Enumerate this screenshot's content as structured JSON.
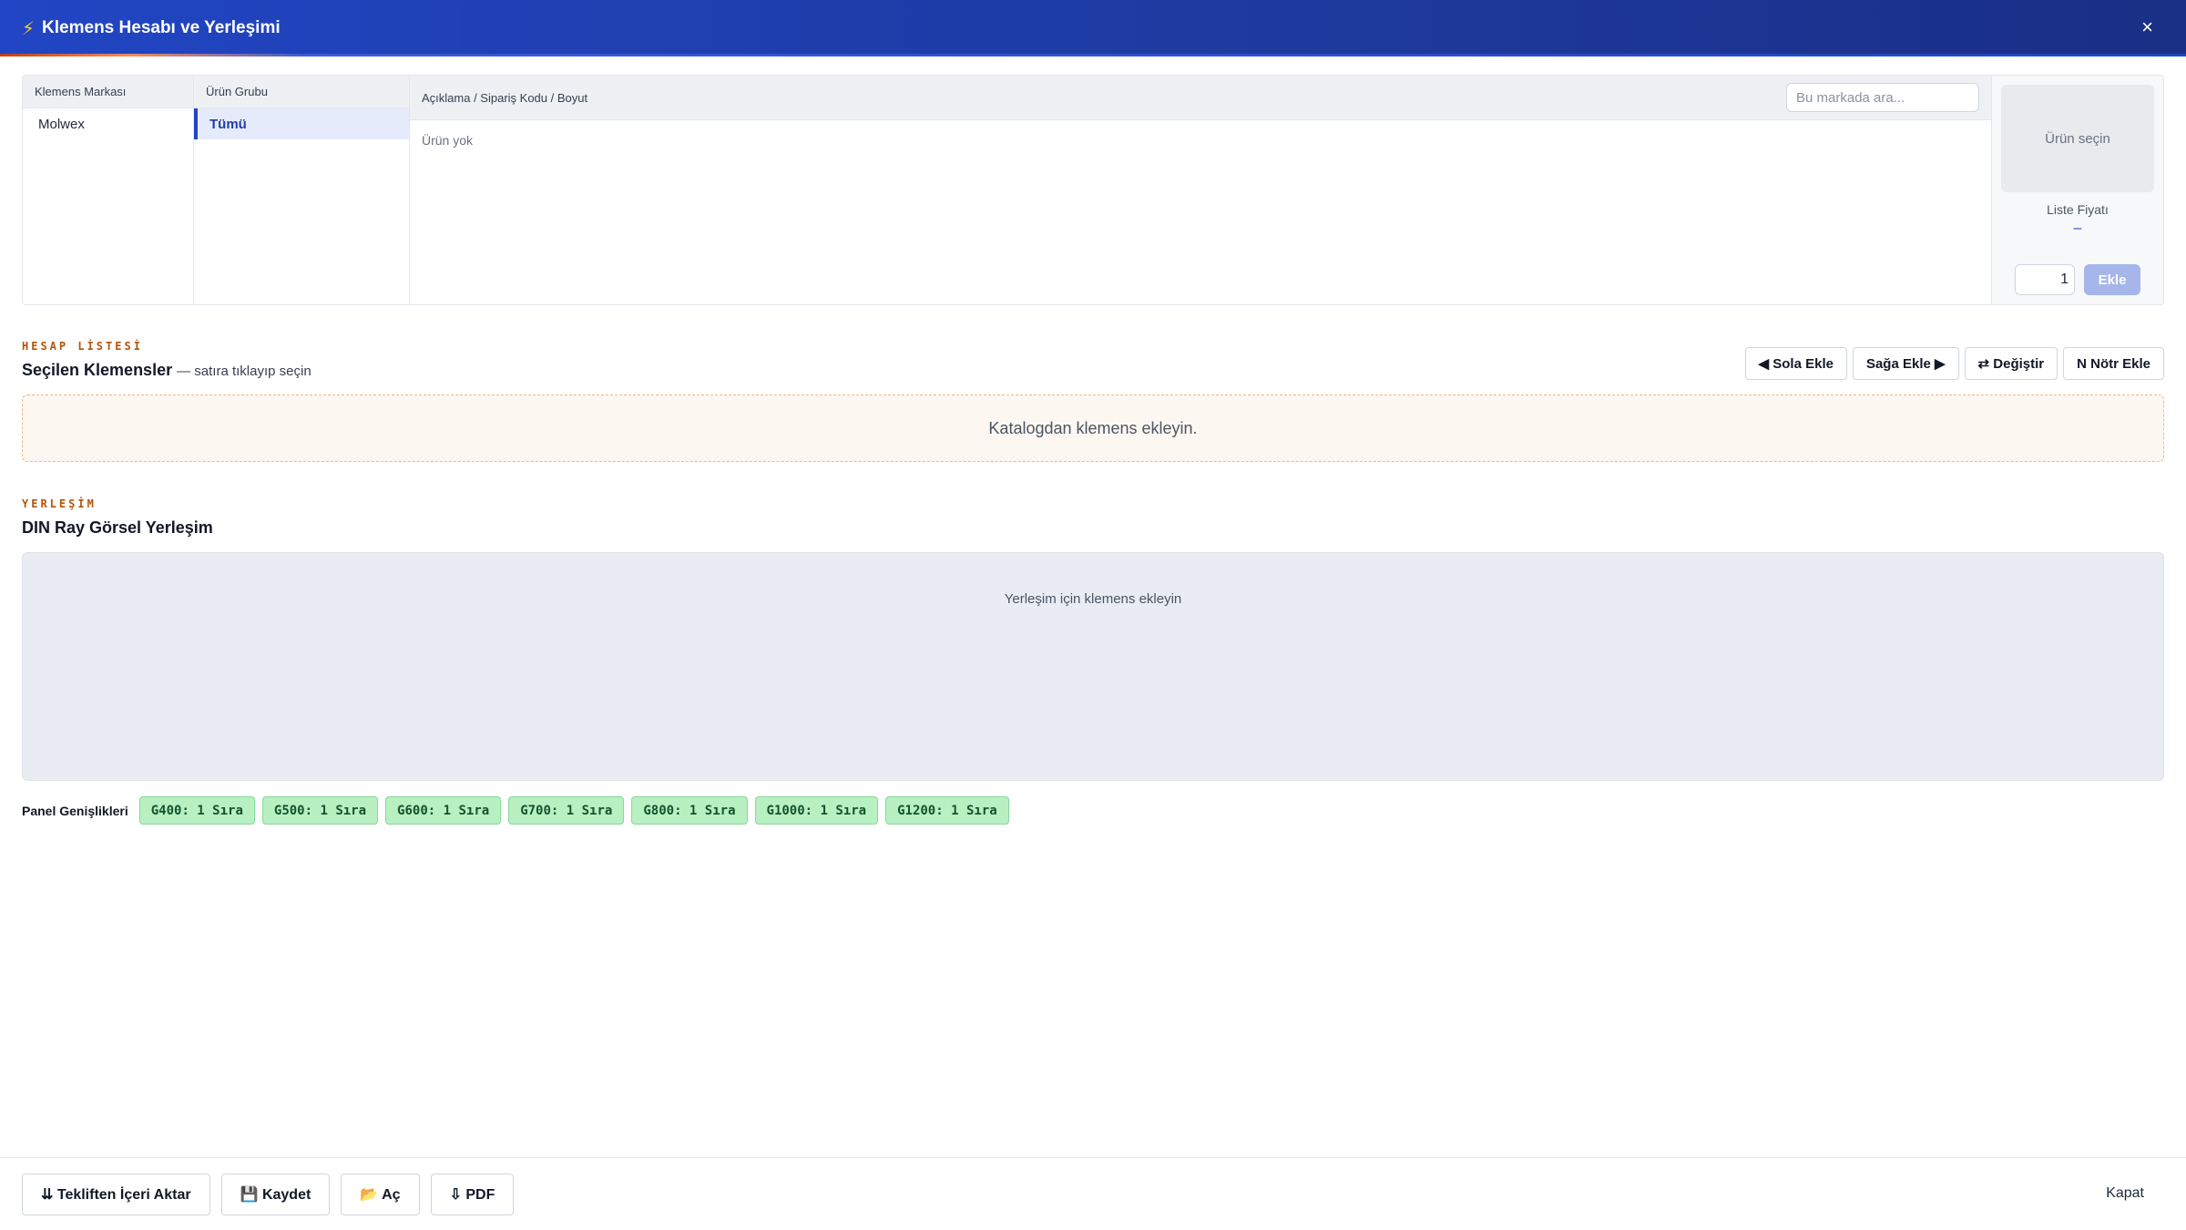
{
  "header": {
    "icon": "lightning-icon",
    "title": "Klemens Hesabı ve Yerleşimi",
    "close_label": "×"
  },
  "catalog": {
    "brand_header": "Klemens Markası",
    "group_header": "Ürün Grubu",
    "desc_header": "Açıklama / Sipariş Kodu / Boyut",
    "search_placeholder": "Bu markada ara...",
    "brands": [
      "Molwex"
    ],
    "groups": [
      "Tümü"
    ],
    "empty_text": "Ürün yok",
    "preview_text": "Ürün seçin",
    "price_label": "Liste Fiyatı",
    "price_value": "–",
    "quantity": "1",
    "add_label": "Ekle"
  },
  "account_list": {
    "eyebrow": "HESAP LİSTESİ",
    "title": "Seçilen Klemensler",
    "subtitle": "— satıra tıklayıp seçin",
    "actions": [
      "◀ Sola Ekle",
      "Sağa Ekle ▶",
      "⇄ Değiştir",
      "N Nötr Ekle"
    ],
    "empty_text": "Katalogdan klemens ekleyin."
  },
  "layout": {
    "eyebrow": "YERLEŞİM",
    "title": "DIN Ray Görsel Yerleşim",
    "empty_text": "Yerleşim için klemens ekleyin"
  },
  "panel_widths": {
    "label": "Panel Genişlikleri",
    "chips": [
      "G400: 1 Sıra",
      "G500: 1 Sıra",
      "G600: 1 Sıra",
      "G700: 1 Sıra",
      "G800: 1 Sıra",
      "G1000: 1 Sıra",
      "G1200: 1 Sıra"
    ]
  },
  "footer": {
    "import_label": "⇊ Tekliften İçeri Aktar",
    "save_label": "💾 Kaydet",
    "open_label": "📂 Aç",
    "pdf_label": "⇩ PDF",
    "close_label": "Kapat"
  },
  "colors": {
    "primary": "#2145c4",
    "accent": "#b45309",
    "chip_bg": "#b8f0c2"
  }
}
